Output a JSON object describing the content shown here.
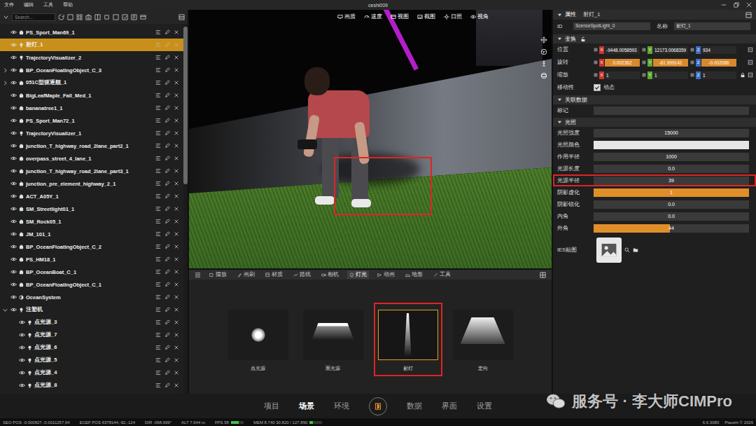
{
  "window": {
    "title": "ceshi009",
    "menu": [
      "文件",
      "编辑",
      "工具",
      "帮助"
    ]
  },
  "outliner": {
    "search_placeholder": "Search...",
    "items": [
      {
        "name": "PS_Sport_Man69_1",
        "kind": "mesh",
        "selected": false,
        "child": false,
        "expandable": false,
        "expanded": false
      },
      {
        "name": "射灯_1",
        "kind": "light",
        "selected": true,
        "child": false,
        "expandable": false,
        "expanded": false
      },
      {
        "name": "TrajectoryVisualizer_2",
        "kind": "light",
        "selected": false,
        "child": false,
        "expandable": false,
        "expanded": false
      },
      {
        "name": "BP_OceanFloatingObject_C_3",
        "kind": "mesh",
        "selected": false,
        "child": false,
        "expandable": true,
        "expanded": false
      },
      {
        "name": "051C型驱逐舰_1",
        "kind": "mesh",
        "selected": false,
        "child": false,
        "expandable": true,
        "expanded": false
      },
      {
        "name": "BigLeafMaple_Fall_Med_1",
        "kind": "mesh",
        "selected": false,
        "child": false,
        "expandable": false,
        "expanded": false
      },
      {
        "name": "bananatree1_1",
        "kind": "mesh",
        "selected": false,
        "child": false,
        "expandable": false,
        "expanded": false
      },
      {
        "name": "PS_Sport_Man72_1",
        "kind": "mesh",
        "selected": false,
        "child": false,
        "expandable": false,
        "expanded": false
      },
      {
        "name": "TrajectoryVisualizer_1",
        "kind": "light",
        "selected": false,
        "child": false,
        "expandable": false,
        "expanded": false
      },
      {
        "name": "junction_T_highway_road_2lane_part2_1",
        "kind": "mesh",
        "selected": false,
        "child": false,
        "expandable": false,
        "expanded": false
      },
      {
        "name": "overpass_street_4_lane_1",
        "kind": "mesh",
        "selected": false,
        "child": false,
        "expandable": false,
        "expanded": false
      },
      {
        "name": "junction_T_highway_road_2lane_part3_1",
        "kind": "mesh",
        "selected": false,
        "child": false,
        "expandable": false,
        "expanded": false
      },
      {
        "name": "junction_pre_element_highway_2_1",
        "kind": "mesh",
        "selected": false,
        "child": false,
        "expandable": false,
        "expanded": false
      },
      {
        "name": "ACT_A05Y_1",
        "kind": "mesh",
        "selected": false,
        "child": false,
        "expandable": false,
        "expanded": false
      },
      {
        "name": "SM_Streetlight01_1",
        "kind": "mesh",
        "selected": false,
        "child": false,
        "expandable": false,
        "expanded": false
      },
      {
        "name": "SM_Rock05_1",
        "kind": "mesh",
        "selected": false,
        "child": false,
        "expandable": false,
        "expanded": false
      },
      {
        "name": "JM_101_1",
        "kind": "mesh",
        "selected": false,
        "child": false,
        "expandable": false,
        "expanded": false
      },
      {
        "name": "BP_OceanFloatingObject_C_2",
        "kind": "mesh",
        "selected": false,
        "child": false,
        "expandable": false,
        "expanded": false
      },
      {
        "name": "PS_HM18_1",
        "kind": "mesh",
        "selected": false,
        "child": false,
        "expandable": false,
        "expanded": false
      },
      {
        "name": "BP_OceanBoat_C_1",
        "kind": "mesh",
        "selected": false,
        "child": false,
        "expandable": false,
        "expanded": false
      },
      {
        "name": "BP_OceanFloatingObject_C_1",
        "kind": "mesh",
        "selected": false,
        "child": false,
        "expandable": false,
        "expanded": false
      },
      {
        "name": "OceanSystem",
        "kind": "system",
        "selected": false,
        "child": false,
        "expandable": false,
        "expanded": false
      },
      {
        "name": "注塑机",
        "kind": "light",
        "selected": false,
        "child": false,
        "expandable": true,
        "expanded": true
      },
      {
        "name": "点光源_3",
        "kind": "light",
        "selected": false,
        "child": true,
        "expandable": false,
        "expanded": false
      },
      {
        "name": "点光源_7",
        "kind": "light",
        "selected": false,
        "child": true,
        "expandable": false,
        "expanded": false
      },
      {
        "name": "点光源_6",
        "kind": "light",
        "selected": false,
        "child": true,
        "expandable": false,
        "expanded": false
      },
      {
        "name": "点光源_5",
        "kind": "light",
        "selected": false,
        "child": true,
        "expandable": false,
        "expanded": false
      },
      {
        "name": "点光源_4",
        "kind": "light",
        "selected": false,
        "child": true,
        "expandable": false,
        "expanded": false
      },
      {
        "name": "点光源_8",
        "kind": "light",
        "selected": false,
        "child": true,
        "expandable": false,
        "expanded": false
      }
    ]
  },
  "viewport": {
    "toolbar": [
      "画质",
      "速度",
      "视图",
      "截图",
      "日照",
      "视角"
    ],
    "annotated": true
  },
  "assets": {
    "tabs": [
      {
        "label": "摆放",
        "selected": false
      },
      {
        "label": "画刷",
        "selected": false
      },
      {
        "label": "材质",
        "selected": false
      },
      {
        "label": "路线",
        "selected": false
      },
      {
        "label": "相机",
        "selected": false
      },
      {
        "label": "灯光",
        "selected": true
      },
      {
        "label": "动画",
        "selected": false
      },
      {
        "label": "地形",
        "selected": false
      },
      {
        "label": "工具",
        "selected": false
      }
    ],
    "items": [
      {
        "label": "点光源",
        "kind": "point",
        "selected": false,
        "annotated": false
      },
      {
        "label": "面光源",
        "kind": "area",
        "selected": false,
        "annotated": false
      },
      {
        "label": "射灯",
        "kind": "spot",
        "selected": true,
        "annotated": true
      },
      {
        "label": "定向",
        "kind": "directional",
        "selected": false,
        "annotated": false
      }
    ]
  },
  "properties": {
    "title": "属性",
    "object": "射灯_1",
    "id_label": "ID",
    "id_value": "ScenceSpotLight_0",
    "name_label": "名称",
    "name_value": "射灯_1",
    "transform": {
      "title": "变换",
      "expanded": true,
      "rows": [
        {
          "label": "位置",
          "modified": false,
          "locked": false,
          "fields": [
            {
              "axis": "X",
              "value": "-9448.0058593",
              "color": "#c8372d"
            },
            {
              "axis": "Y",
              "value": "12173.0068359",
              "color": "#5fa82c"
            },
            {
              "axis": "Z",
              "value": "934",
              "color": "#3d6fc4"
            }
          ]
        },
        {
          "label": "旋转",
          "modified": true,
          "locked": false,
          "fields": [
            {
              "axis": "X",
              "value": "0.002362",
              "color": "#c8372d"
            },
            {
              "axis": "Y",
              "value": "-61.999142",
              "color": "#5fa82c"
            },
            {
              "axis": "Z",
              "value": "-0.002086",
              "color": "#3d6fc4"
            }
          ]
        },
        {
          "label": "缩放",
          "modified": false,
          "locked": true,
          "fields": [
            {
              "axis": "X",
              "value": "1",
              "color": "#c8372d"
            },
            {
              "axis": "Y",
              "value": "1",
              "color": "#5fa82c"
            },
            {
              "axis": "Z",
              "value": "1",
              "color": "#3d6fc4"
            }
          ]
        }
      ],
      "mobility": {
        "label": "移动性",
        "checked": true,
        "text": "动态"
      }
    },
    "related": {
      "title": "关联数据",
      "expanded": true,
      "rows": [
        {
          "label": "标记",
          "value": ""
        }
      ]
    },
    "lighting": {
      "title": "光照",
      "expanded": true,
      "rows": [
        {
          "label": "光照强度",
          "kind": "number",
          "value": "15000",
          "annotated": false
        },
        {
          "label": "光照颜色",
          "kind": "color",
          "color": "#e6e6e6",
          "annotated": false
        },
        {
          "label": "作用半径",
          "kind": "number",
          "value": "1000",
          "annotated": false
        },
        {
          "label": "光源长度",
          "kind": "number",
          "value": "0.0",
          "annotated": false
        },
        {
          "label": "光源半径",
          "kind": "number",
          "value": "39",
          "annotated": true
        },
        {
          "label": "阴影虚化",
          "kind": "slider",
          "value": "1",
          "level": 1,
          "annotated": false
        },
        {
          "label": "阴影锐化",
          "kind": "number",
          "value": "0.0",
          "annotated": false
        },
        {
          "label": "内角",
          "kind": "number",
          "value": "0.0",
          "annotated": false
        },
        {
          "label": "外角",
          "kind": "slider",
          "value": "44",
          "level": 0.49,
          "annotated": false
        },
        {
          "label": "IES贴图",
          "kind": "texture",
          "annotated": false
        }
      ]
    }
  },
  "nav": {
    "left": [
      {
        "label": "项目",
        "selected": false
      },
      {
        "label": "场景",
        "selected": true
      },
      {
        "label": "环境",
        "selected": false
      }
    ],
    "right": [
      {
        "label": "数据",
        "selected": false
      },
      {
        "label": "界面",
        "selected": false
      },
      {
        "label": "设置",
        "selected": false
      }
    ]
  },
  "status_bar": {
    "items": [
      {
        "text": "SEO POS -0.000827,-0.0011257,64"
      },
      {
        "text": "ECEF POS 6378144,-92,-124"
      },
      {
        "text": "DIR -098.699°"
      },
      {
        "text": "ALT 7.644 m"
      },
      {
        "text": "FPS 58",
        "level": 0.6
      },
      {
        "text": "MEM 8.740 30.820 / 127.890",
        "level": 0.25
      }
    ],
    "version": "6.6.3080",
    "copyright": "Piaoshi © 2026"
  },
  "watermark": {
    "text": "服务号 · 李大师CIMPro"
  }
}
